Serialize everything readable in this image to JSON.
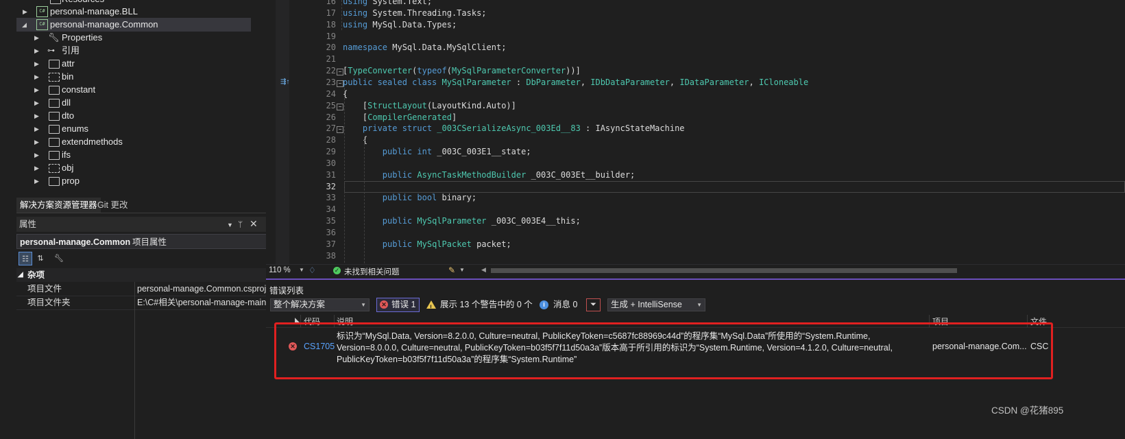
{
  "solution_explorer": {
    "items": [
      {
        "label": "Resources",
        "icon": "folder-icon"
      },
      {
        "label": "personal-manage.BLL",
        "icon": "csharp-project-icon"
      },
      {
        "label": "personal-manage.Common",
        "icon": "csharp-project-icon"
      },
      {
        "label": "Properties",
        "icon": "wrench-icon"
      },
      {
        "label": "引用",
        "icon": "references-icon"
      },
      {
        "label": "attr",
        "icon": "folder-icon"
      },
      {
        "label": "bin",
        "icon": "folder-dashed-icon"
      },
      {
        "label": "constant",
        "icon": "folder-icon"
      },
      {
        "label": "dll",
        "icon": "folder-icon"
      },
      {
        "label": "dto",
        "icon": "folder-icon"
      },
      {
        "label": "enums",
        "icon": "folder-icon"
      },
      {
        "label": "extendmethods",
        "icon": "folder-icon"
      },
      {
        "label": "ifs",
        "icon": "folder-icon"
      },
      {
        "label": "obj",
        "icon": "folder-dashed-icon"
      },
      {
        "label": "prop",
        "icon": "folder-icon"
      }
    ],
    "tabs": [
      "解决方案资源管理器",
      "Git 更改"
    ]
  },
  "properties": {
    "title": "属性",
    "object_name": "personal-manage.Common",
    "object_type": "项目属性",
    "category": "杂项",
    "rows": [
      {
        "key": "项目文件",
        "value": "personal-manage.Common.csproj"
      },
      {
        "key": "项目文件夹",
        "value": "E:\\C#相关\\personal-manage-main"
      }
    ]
  },
  "editor": {
    "lines": [
      {
        "n": "16",
        "parts": [
          [
            "kw",
            "using"
          ],
          [
            "pl",
            " System.Text;"
          ]
        ]
      },
      {
        "n": "17",
        "parts": [
          [
            "kw",
            "using"
          ],
          [
            "pl",
            " System.Threading.Tasks;"
          ]
        ]
      },
      {
        "n": "18",
        "parts": [
          [
            "kw",
            "using"
          ],
          [
            "pl",
            " MySql.Data.Types;"
          ]
        ]
      },
      {
        "n": "19",
        "parts": []
      },
      {
        "n": "20",
        "parts": [
          [
            "kw",
            "namespace"
          ],
          [
            "pl",
            " MySql.Data.MySqlClient;"
          ]
        ]
      },
      {
        "n": "21",
        "parts": []
      },
      {
        "n": "22",
        "parts": [
          [
            "pl",
            "["
          ],
          [
            "at",
            "TypeConverter"
          ],
          [
            "pl",
            "("
          ],
          [
            "kw",
            "typeof"
          ],
          [
            "pl",
            "("
          ],
          [
            "ty",
            "MySqlParameterConverter"
          ],
          [
            "pl",
            "))]"
          ]
        ]
      },
      {
        "n": "23",
        "parts": [
          [
            "kw",
            "public sealed class"
          ],
          [
            "pl",
            " "
          ],
          [
            "ty",
            "MySqlParameter"
          ],
          [
            "pl",
            " : "
          ],
          [
            "ty",
            "DbParameter"
          ],
          [
            "pl",
            ", "
          ],
          [
            "ty",
            "IDbDataParameter"
          ],
          [
            "pl",
            ", "
          ],
          [
            "ty",
            "IDataParameter"
          ],
          [
            "pl",
            ", "
          ],
          [
            "ty",
            "ICloneable"
          ]
        ]
      },
      {
        "n": "24",
        "parts": [
          [
            "pl",
            "{"
          ]
        ]
      },
      {
        "n": "25",
        "parts": [
          [
            "pl",
            "    ["
          ],
          [
            "at",
            "StructLayout"
          ],
          [
            "pl",
            "(LayoutKind.Auto)]"
          ]
        ]
      },
      {
        "n": "26",
        "parts": [
          [
            "pl",
            "    ["
          ],
          [
            "at",
            "CompilerGenerated"
          ],
          [
            "pl",
            "]"
          ]
        ]
      },
      {
        "n": "27",
        "parts": [
          [
            "pl",
            "    "
          ],
          [
            "kw",
            "private struct"
          ],
          [
            "pl",
            " "
          ],
          [
            "ty",
            "_003CSerializeAsync_003Ed__83"
          ],
          [
            "pl",
            " : IAsyncStateMachine"
          ]
        ]
      },
      {
        "n": "28",
        "parts": [
          [
            "pl",
            "    {"
          ]
        ]
      },
      {
        "n": "29",
        "parts": [
          [
            "pl",
            "        "
          ],
          [
            "kw",
            "public int"
          ],
          [
            "pl",
            " _003C_003E1__state;"
          ]
        ]
      },
      {
        "n": "30",
        "parts": []
      },
      {
        "n": "31",
        "parts": [
          [
            "pl",
            "        "
          ],
          [
            "kw",
            "public"
          ],
          [
            "pl",
            " "
          ],
          [
            "ty",
            "AsyncTaskMethodBuilder"
          ],
          [
            "pl",
            " _003C_003Et__builder;"
          ]
        ]
      },
      {
        "n": "32",
        "parts": []
      },
      {
        "n": "33",
        "parts": [
          [
            "pl",
            "        "
          ],
          [
            "kw",
            "public bool"
          ],
          [
            "pl",
            " binary;"
          ]
        ]
      },
      {
        "n": "34",
        "parts": []
      },
      {
        "n": "35",
        "parts": [
          [
            "pl",
            "        "
          ],
          [
            "kw",
            "public"
          ],
          [
            "pl",
            " "
          ],
          [
            "ty",
            "MySqlParameter"
          ],
          [
            "pl",
            " _003C_003E4__this;"
          ]
        ]
      },
      {
        "n": "36",
        "parts": []
      },
      {
        "n": "37",
        "parts": [
          [
            "pl",
            "        "
          ],
          [
            "kw",
            "public"
          ],
          [
            "pl",
            " "
          ],
          [
            "ty",
            "MySqlPacket"
          ],
          [
            "pl",
            " packet;"
          ]
        ]
      },
      {
        "n": "38",
        "parts": []
      }
    ],
    "current_line": "32",
    "colors": {
      "keyword": "#569cd6",
      "type": "#4ec9b0",
      "plain": "#dcdcdc"
    }
  },
  "editor_status": {
    "zoom": "110 %",
    "issues_text": "未找到相关问题"
  },
  "error_list": {
    "title": "错误列表",
    "scope": "整个解决方案",
    "errors_label": "错误 1",
    "warnings_label": "展示 13 个警告中的 0 个",
    "messages_label": "消息 0",
    "build_filter": "生成 + IntelliSense",
    "columns": {
      "code": "代码",
      "description": "说明",
      "project": "项目",
      "file": "文件"
    },
    "rows": [
      {
        "code": "CS1705",
        "description": "标识为“MySql.Data, Version=8.2.0.0, Culture=neutral, PublicKeyToken=c5687fc88969c44d”的程序集“MySql.Data”所使用的“System.Runtime, Version=8.0.0.0, Culture=neutral, PublicKeyToken=b03f5f7f11d50a3a”版本高于所引用的标识为“System.Runtime, Version=4.1.2.0, Culture=neutral, PublicKeyToken=b03f5f7f11d50a3a”的程序集“System.Runtime”",
        "project": "personal-manage.Com...",
        "file": "CSC"
      }
    ]
  },
  "watermark": "CSDN @花猪895"
}
